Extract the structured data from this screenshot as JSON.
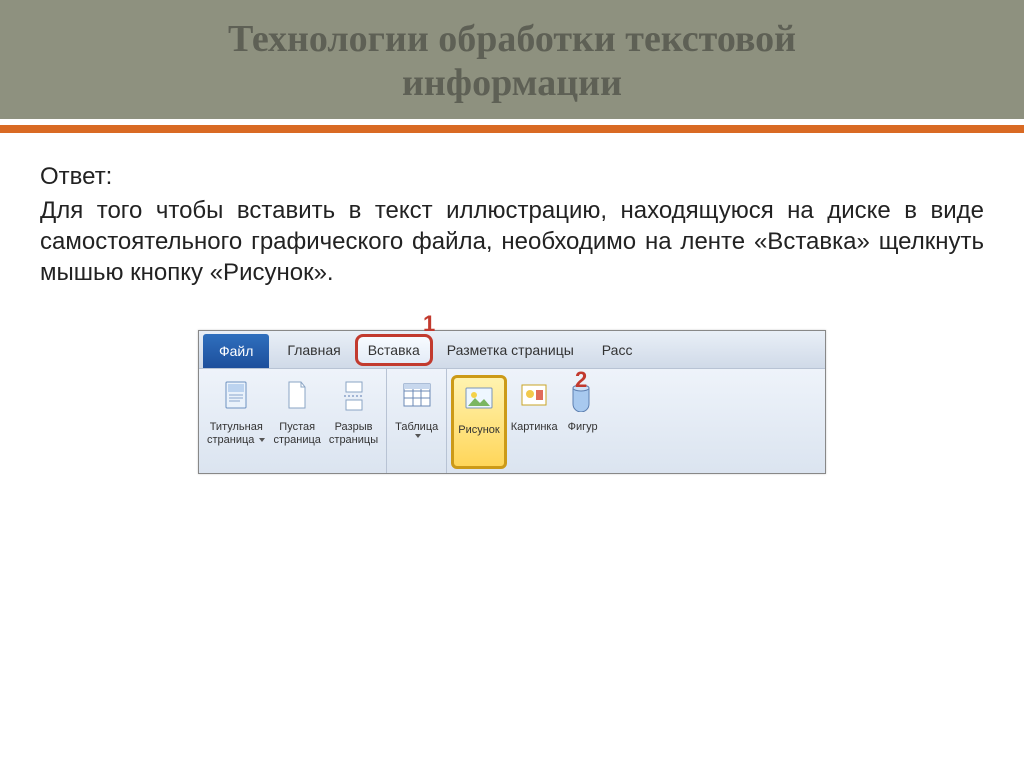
{
  "slide": {
    "title_line1": "Технологии обработки текстовой",
    "title_line2": "информации"
  },
  "answer": {
    "label": "Ответ:",
    "text": "Для того чтобы вставить в текст иллюстрацию, находящуюся на диске в виде самостоятельного графического файла, необходимо на ленте «Вставка» щелкнуть мышью кнопку «Рисунок»."
  },
  "callouts": {
    "one": "1",
    "two": "2"
  },
  "ribbon": {
    "tabs": {
      "file": "Файл",
      "home": "Главная",
      "insert": "Вставка",
      "layout": "Разметка страницы",
      "mail": "Расс"
    },
    "buttons": {
      "cover_page_l1": "Титульная",
      "cover_page_l2": "страница",
      "blank_page_l1": "Пустая",
      "blank_page_l2": "страница",
      "page_break_l1": "Разрыв",
      "page_break_l2": "страницы",
      "table": "Таблица",
      "picture": "Рисунок",
      "clipart": "Картинка",
      "shapes": "Фигур"
    }
  }
}
